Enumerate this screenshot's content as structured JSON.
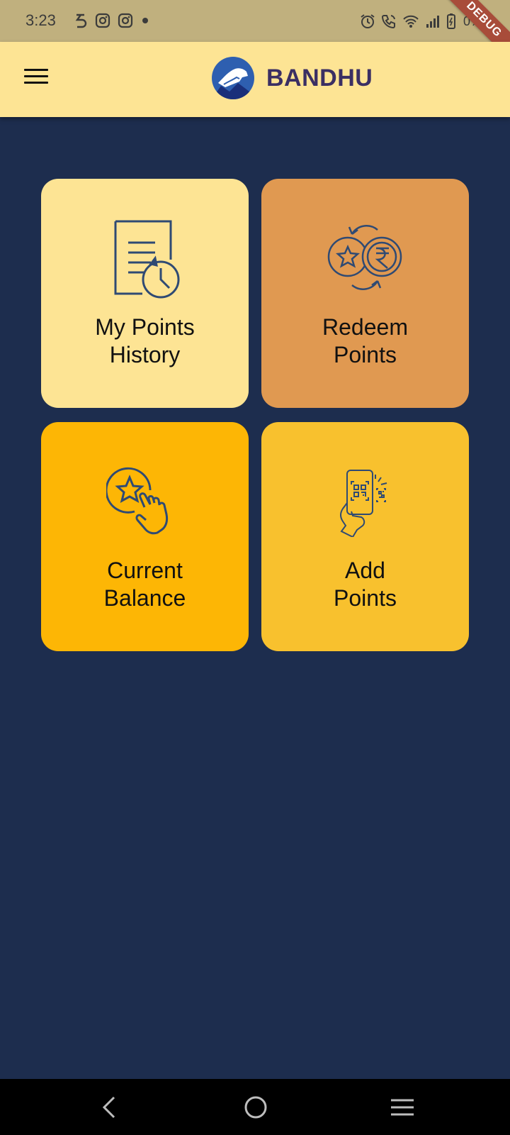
{
  "status_bar": {
    "time": "3:23",
    "battery": "0%",
    "icons_left": [
      "s-app-icon",
      "instagram-icon",
      "instagram-icon",
      "dot-icon"
    ],
    "icons_right": [
      "alarm-icon",
      "call-icon",
      "wifi-icon",
      "signal-icon",
      "battery-icon"
    ]
  },
  "debug_banner": "DEBUG",
  "app_bar": {
    "title": "BANDHU",
    "menu_icon": "hamburger-menu-icon",
    "logo_icon": "handshake-logo-icon"
  },
  "tiles": [
    {
      "label": "My Points\nHistory",
      "icon": "document-history-icon",
      "color": "#fde494"
    },
    {
      "label": "Redeem\nPoints",
      "icon": "coin-exchange-icon",
      "color": "#e09951"
    },
    {
      "label": "Current\nBalance",
      "icon": "star-tap-icon",
      "color": "#fdb605"
    },
    {
      "label": "Add\nPoints",
      "icon": "qr-scan-phone-icon",
      "color": "#f8c12e"
    }
  ],
  "nav_bar": {
    "back_icon": "back-icon",
    "home_icon": "home-icon",
    "recents_icon": "recents-icon"
  },
  "colors": {
    "background": "#1d2d4e",
    "app_bar": "#fde494",
    "status_bar": "#c0b07e",
    "icon_stroke": "#2f4a73",
    "brand_text": "#3b2f63"
  }
}
